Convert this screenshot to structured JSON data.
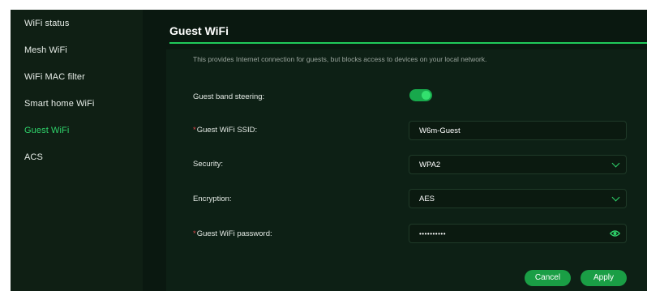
{
  "sidebar": {
    "items": [
      {
        "label": "WiFi status"
      },
      {
        "label": "Mesh WiFi"
      },
      {
        "label": "WiFi MAC filter"
      },
      {
        "label": "Smart home WiFi"
      },
      {
        "label": "Guest WiFi"
      },
      {
        "label": "ACS"
      }
    ],
    "active": "Guest WiFi"
  },
  "page": {
    "title": "Guest WiFi",
    "description": "This provides Internet connection for guests, but blocks access to devices on your local network."
  },
  "form": {
    "band_steering": {
      "label": "Guest band steering:",
      "enabled": true
    },
    "ssid": {
      "required_mark": "*",
      "label": "Guest WiFi SSID:",
      "value": "W6m-Guest"
    },
    "security": {
      "label": "Security:",
      "value": "WPA2"
    },
    "encryption": {
      "label": "Encryption:",
      "value": "AES"
    },
    "password": {
      "required_mark": "*",
      "label": "Guest WiFi password:",
      "value": "••••••••••"
    }
  },
  "buttons": {
    "cancel": "Cancel",
    "apply": "Apply"
  },
  "colors": {
    "accent": "#2fd36b",
    "button": "#1a9e45",
    "background": "#0b1a10"
  },
  "icons": {
    "select": "chevron-down-icon",
    "password_toggle": "eye-icon"
  }
}
